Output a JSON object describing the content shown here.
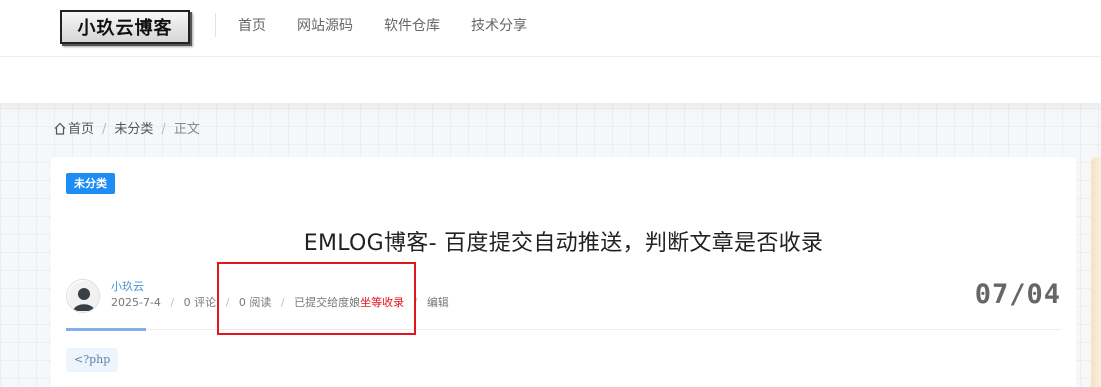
{
  "header": {
    "logo_text": "小玖云博客",
    "nav": [
      "首页",
      "网站源码",
      "软件仓库",
      "技术分享"
    ]
  },
  "breadcrumb": {
    "home": "首页",
    "category": "未分类",
    "current": "正文"
  },
  "post": {
    "category_badge": "未分类",
    "title": "EMLOG博客- 百度提交自动推送，判断文章是否收录",
    "author": "小玖云",
    "date": "2025-7-4",
    "comments": "0 评论",
    "reads": "0 阅读",
    "baidu_status_prefix": "已提交给度娘",
    "baidu_status_highlight": "坐等收录",
    "edit": "编辑",
    "date_big": "07/04",
    "code_chip": "<?php"
  },
  "colors": {
    "accent": "#1e8cf5",
    "highlight_red": "#e0171c",
    "status_red": "#e8121d"
  },
  "icons": [
    "home-icon",
    "avatar"
  ]
}
